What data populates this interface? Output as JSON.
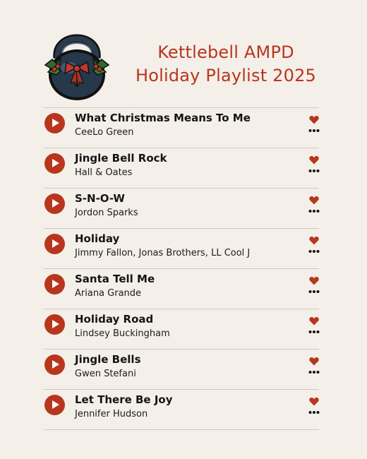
{
  "header": {
    "title_line1": "Kettlebell AMPD",
    "title_line2": "Holiday Playlist 2025",
    "logo_icon": "kettlebell-holly-bow-icon"
  },
  "colors": {
    "accent": "#b8361d",
    "background": "#f4efe9",
    "divider": "#cfc9c2",
    "text": "#141414"
  },
  "tracks": [
    {
      "title": "What Christmas Means To Me",
      "artist": "CeeLo Green"
    },
    {
      "title": "Jingle Bell Rock",
      "artist": "Hall & Oates"
    },
    {
      "title": "S-N-O-W",
      "artist": "Jordon Sparks"
    },
    {
      "title": "Holiday",
      "artist": "Jimmy Fallon, Jonas Brothers, LL Cool J"
    },
    {
      "title": "Santa Tell Me",
      "artist": "Ariana Grande"
    },
    {
      "title": "Holiday Road",
      "artist": "Lindsey Buckingham"
    },
    {
      "title": "Jingle Bells",
      "artist": "Gwen Stefani"
    },
    {
      "title": "Let There Be Joy",
      "artist": "Jennifer Hudson"
    }
  ]
}
